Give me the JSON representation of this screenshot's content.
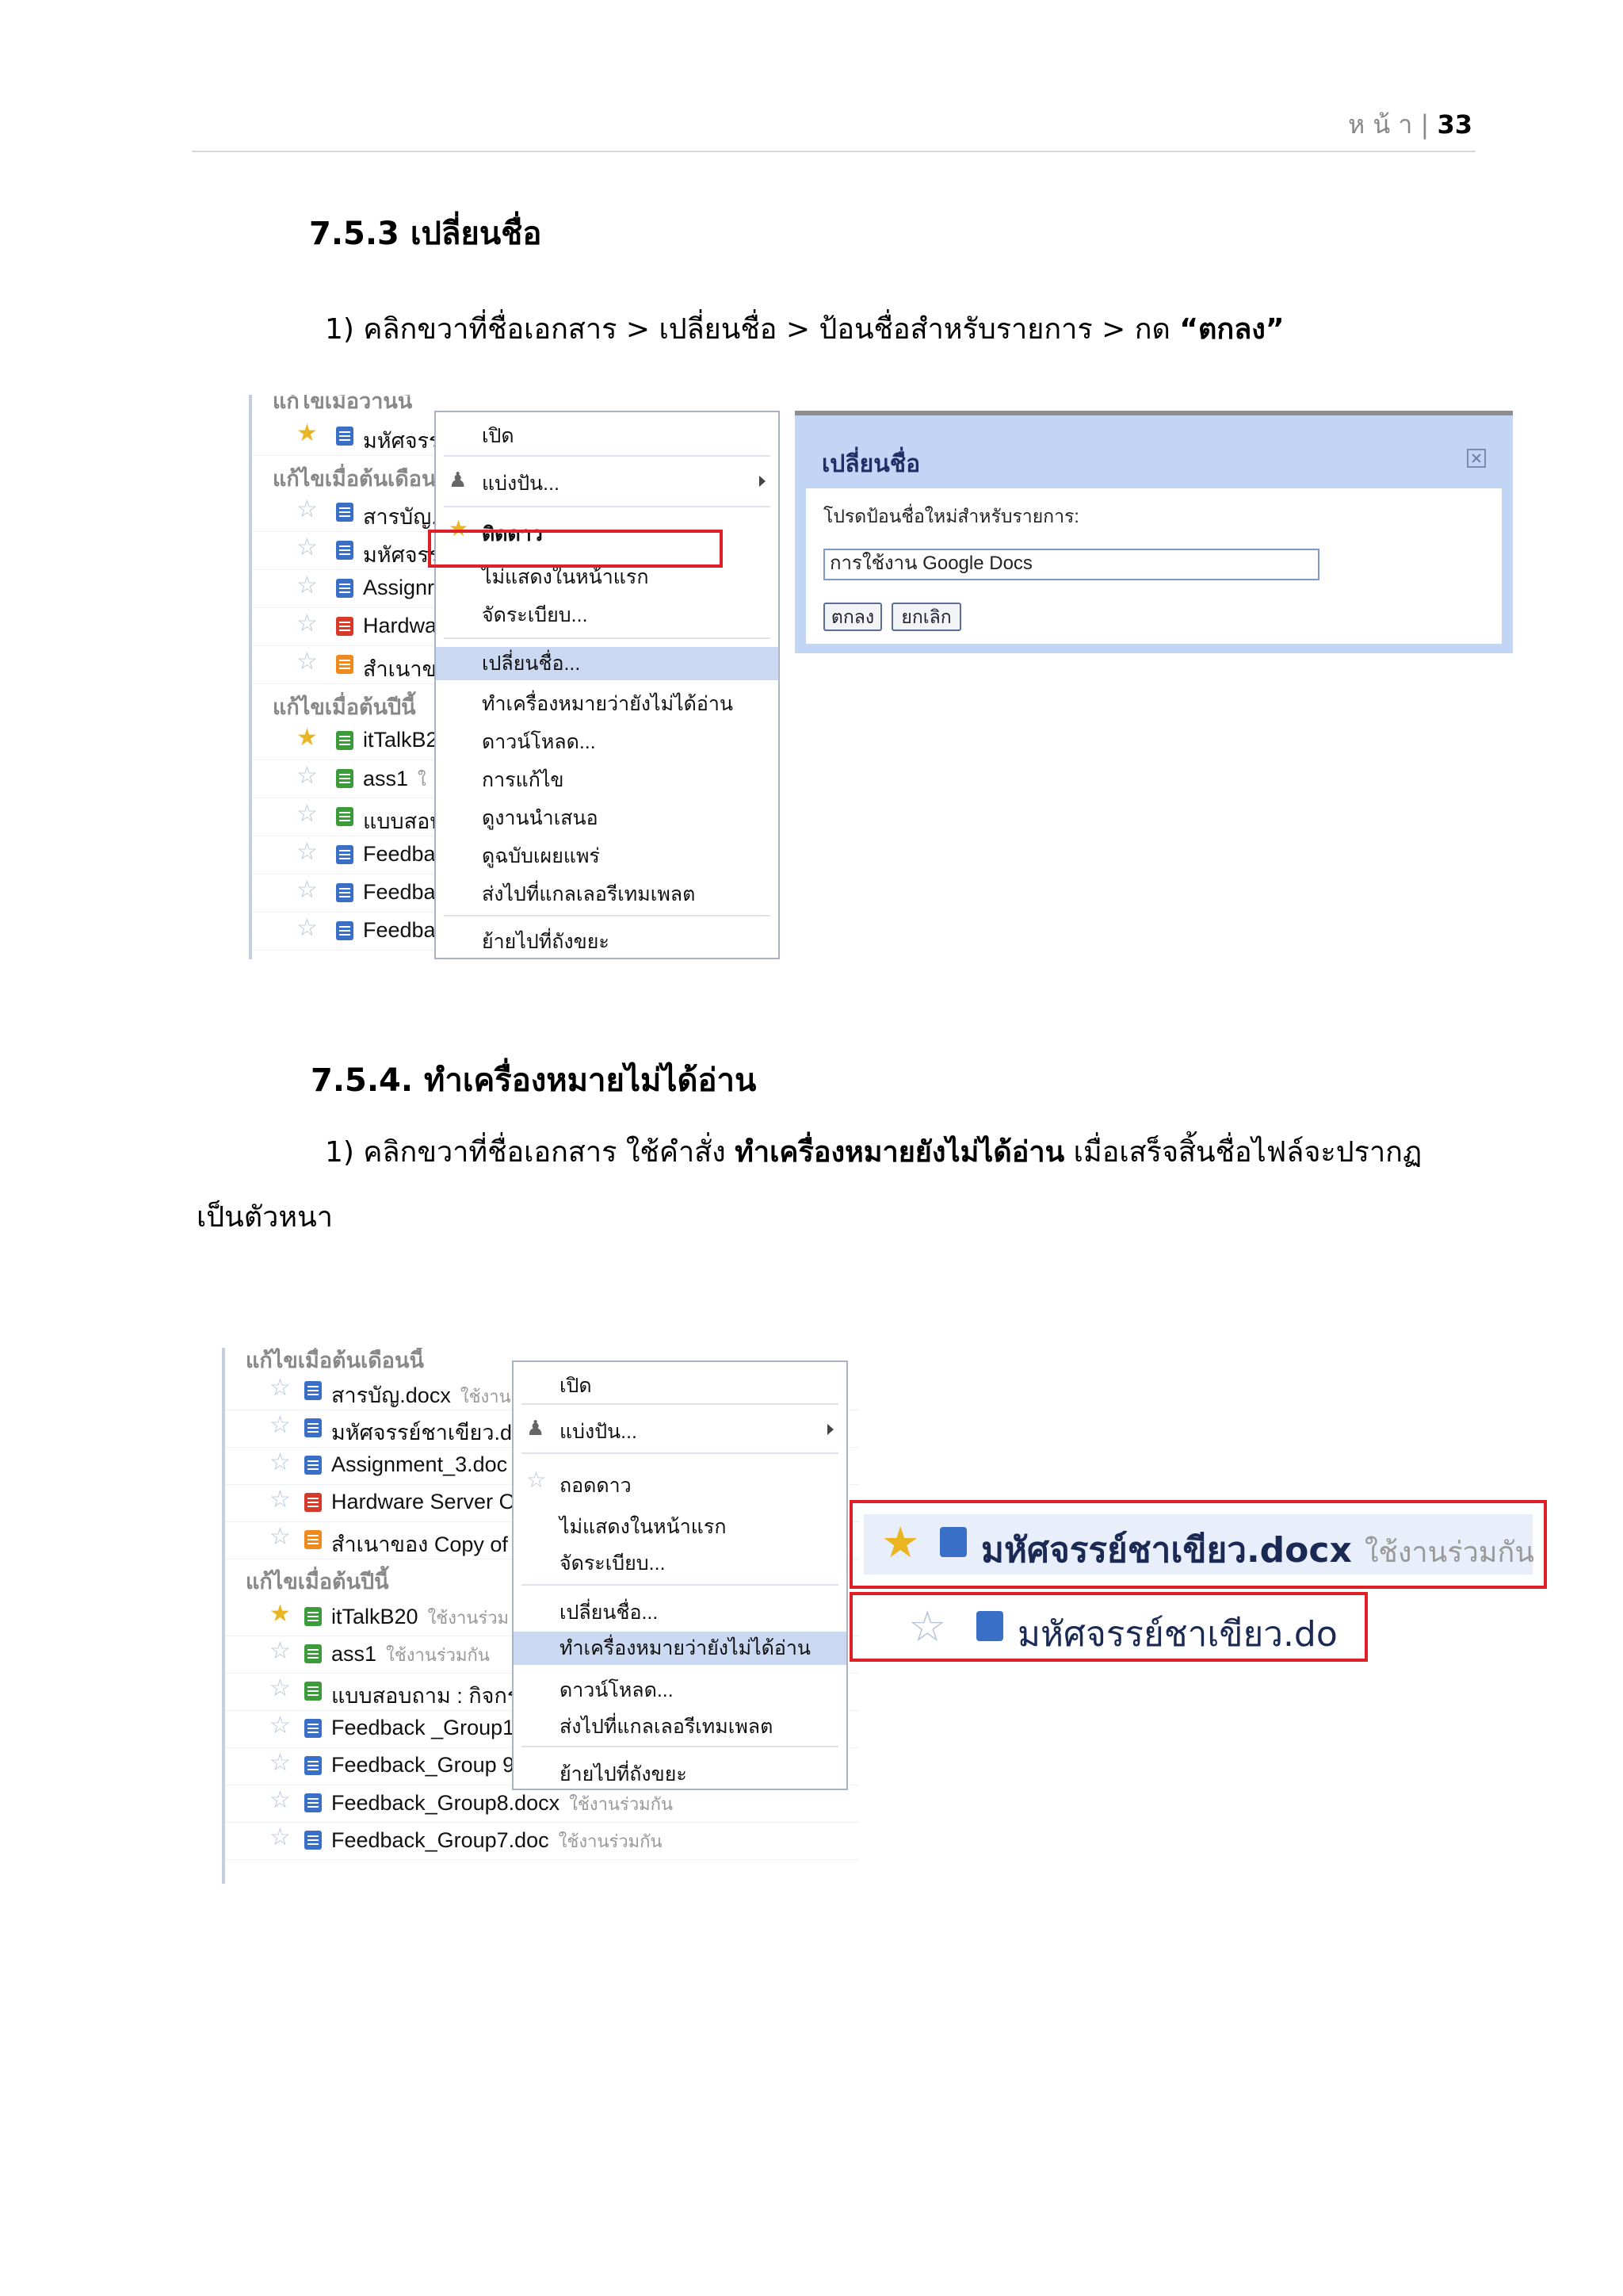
{
  "header": {
    "page_word": "ห น้ า",
    "page_number": "33"
  },
  "section1": {
    "heading": "7.5.3 เปลี่ยนชื่อ",
    "instruction_prefix": "1) คลิกขวาที่ชื่อเอกสาร > เปลี่ยนชื่อ > ป้อนชื่อสำหรับรายการ > กด ",
    "instruction_bold": "“ตกลง”",
    "screenshot_list": {
      "top_group_label": "แก้ไขเมื่อวานนี้",
      "top_rows": [
        {
          "name": "มหัศจรร",
          "starred": true,
          "color": "blue"
        }
      ],
      "group_month": "แก้ไขเมื่อต้นเดือน",
      "month_rows": [
        {
          "name": "สารบัญ.",
          "starred": false,
          "color": "blue"
        },
        {
          "name": "มหัศจรร",
          "starred": false,
          "color": "blue"
        },
        {
          "name": "Assignr",
          "starred": false,
          "color": "blue"
        },
        {
          "name": "Hardwa",
          "starred": false,
          "color": "red"
        },
        {
          "name": "สำเนาข",
          "starred": false,
          "color": "orange"
        }
      ],
      "group_year": "แก้ไขเมื่อต้นปีนี้",
      "year_rows": [
        {
          "name": "itTalkB2",
          "starred": true,
          "color": "green"
        },
        {
          "name": "ass1",
          "starred": false,
          "color": "green",
          "suffix": "ใ"
        },
        {
          "name": "แบบสอบ",
          "starred": false,
          "color": "green"
        },
        {
          "name": "Feedba",
          "starred": false,
          "color": "blue"
        },
        {
          "name": "Feedba",
          "starred": false,
          "color": "blue"
        },
        {
          "name": "Feedba",
          "starred": false,
          "color": "blue"
        }
      ]
    },
    "context_menu": {
      "open": "เปิด",
      "share": "แบ่งปัน...",
      "star": "ติดดาว",
      "hide": "ไม่แสดงในหน้าแรก",
      "organize": "จัดระเบียบ...",
      "rename": "เปลี่ยนชื่อ...",
      "mark_unread": "ทำเครื่องหมายว่ายังไม่ได้อ่าน",
      "download": "ดาวน์โหลด...",
      "revisions": "การแก้ไข",
      "view_presentation": "ดูงานนำเสนอ",
      "view_published": "ดูฉบับเผยแพร่",
      "send_template": "ส่งไปที่แกลเลอรีเทมเพลต",
      "trash": "ย้ายไปที่ถังขยะ"
    },
    "dialog": {
      "title": "เปลี่ยนชื่อ",
      "prompt": "โปรดป้อนชื่อใหม่สำหรับรายการ:",
      "input_value": "การใช้งาน Google Docs",
      "ok": "ตกลง",
      "cancel": "ยกเลิก"
    }
  },
  "section2": {
    "heading": "7.5.4. ทำเครื่องหมายไม่ได้อ่าน",
    "instruction_prefix": "1) คลิกขวาที่ชื่อเอกสาร ใช้คำสั่ง ",
    "instruction_bold": "ทำเครื่องหมายยังไม่ได้อ่าน",
    "instruction_suffix": " เมื่อเสร็จสิ้นชื่อไฟล์จะปรากฏ",
    "instruction_line2": "เป็นตัวหนา",
    "screenshot_list": {
      "group_month": "แก้ไขเมื่อต้นเดือนนี้",
      "month_rows": [
        {
          "name": "สารบัญ.docx",
          "shared": "ใช้งาน",
          "color": "blue",
          "starred": false
        },
        {
          "name": "มหัศจรรย์ชาเขียว.do",
          "shared": "",
          "color": "blue",
          "starred": false
        },
        {
          "name": "Assignment_3.doc",
          "shared": "",
          "color": "blue",
          "starred": false
        },
        {
          "name": "Hardware Server O",
          "shared": "",
          "color": "red",
          "starred": false
        },
        {
          "name": "สำเนาของ Copy of",
          "shared": "",
          "color": "orange",
          "starred": false
        }
      ],
      "group_year": "แก้ไขเมื่อต้นปีนี้",
      "year_rows": [
        {
          "name": "itTalkB20",
          "shared": "ใช้งานร่วม",
          "color": "green",
          "starred": true
        },
        {
          "name": "ass1",
          "shared": "ใช้งานร่วมกัน",
          "color": "green",
          "starred": false
        },
        {
          "name": "แบบสอบถาม : กิจกร",
          "shared": "",
          "color": "green",
          "starred": false
        },
        {
          "name": "Feedback _Group1",
          "shared": "",
          "color": "blue",
          "starred": false
        },
        {
          "name": "Feedback_Group 9",
          "shared": "",
          "color": "blue",
          "starred": false
        },
        {
          "name": "Feedback_Group8.docx",
          "shared": "ใช้งานร่วมกัน",
          "color": "blue",
          "starred": false
        },
        {
          "name": "Feedback_Group7.doc",
          "shared": "ใช้งานร่วมกัน",
          "color": "blue",
          "starred": false
        }
      ]
    },
    "context_menu": {
      "open": "เปิด",
      "share": "แบ่งปัน...",
      "unstar": "ถอดดาว",
      "hide": "ไม่แสดงในหน้าแรก",
      "organize": "จัดระเบียบ...",
      "rename": "เปลี่ยนชื่อ...",
      "mark_unread": "ทำเครื่องหมายว่ายังไม่ได้อ่าน",
      "download": "ดาวน์โหลด...",
      "send_template": "ส่งไปที่แกลเลอรีเทมเพลต",
      "trash": "ย้ายไปที่ถังขยะ"
    },
    "zoom_bold": {
      "name": "มหัศจรรย์ชาเขียว.docx",
      "shared": "ใช้งานร่วมกัน"
    },
    "zoom_normal": {
      "name": "มหัศจรรย์ชาเขียว.do"
    }
  },
  "colors": {
    "doc_blue": "#3a6fc7",
    "pdf_red": "#d83a2a",
    "slides_orange": "#f08a1c",
    "sheet_green": "#3c9b3a",
    "highlight": "#e01e26",
    "menu_highlight": "#cbd8f1"
  }
}
